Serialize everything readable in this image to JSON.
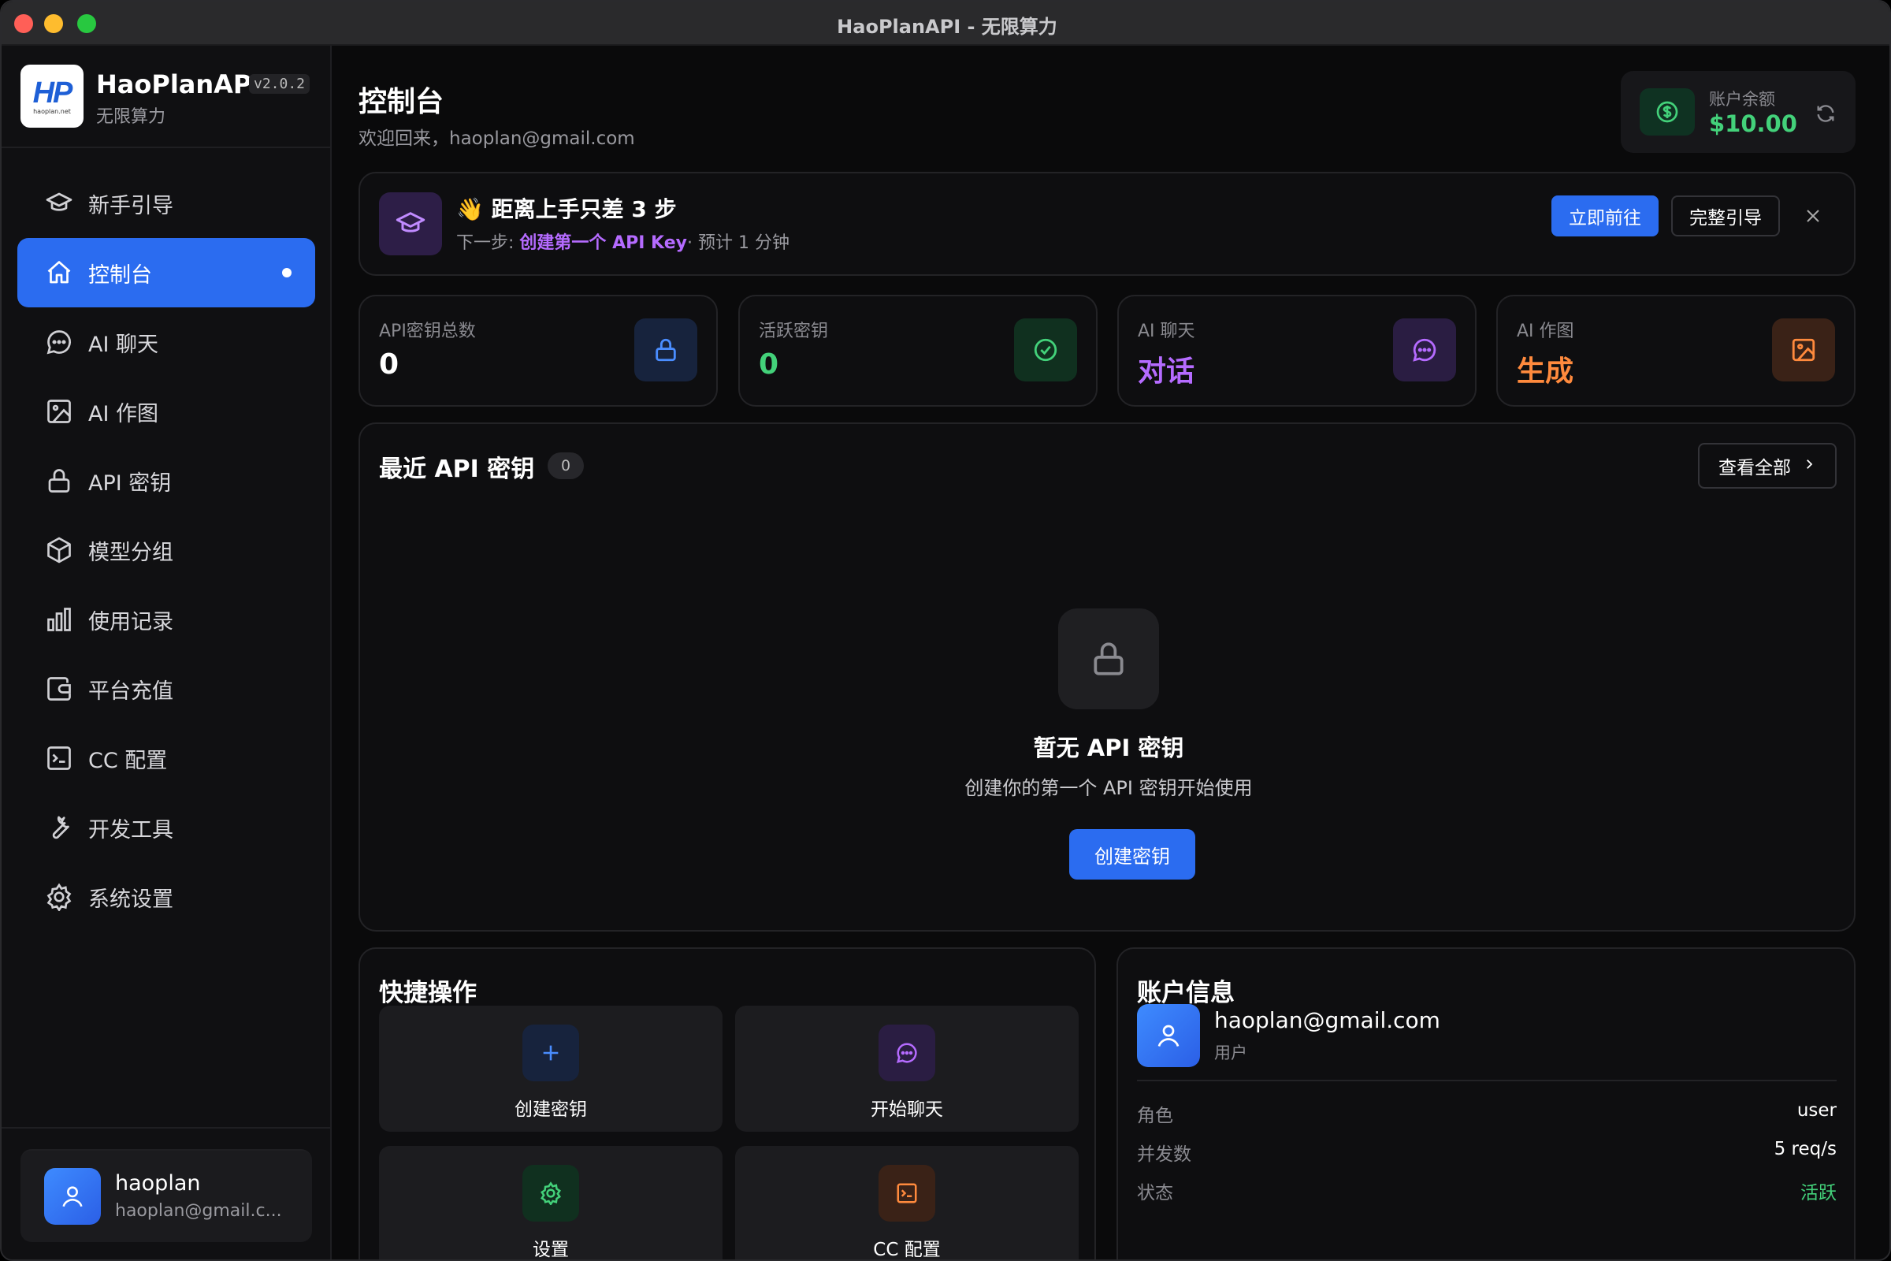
{
  "window": {
    "title": "HaoPlanAPI - 无限算力"
  },
  "brand": {
    "name": "HaoPlanAPI",
    "version": "v2.0.2",
    "subtitle": "无限算力",
    "logo_text": "HP",
    "logo_sub": "haoplan.net"
  },
  "sidebar": {
    "items": [
      {
        "label": "新手引导",
        "icon": "graduation-cap-icon",
        "active": false
      },
      {
        "label": "控制台",
        "icon": "home-icon",
        "active": true
      },
      {
        "label": "AI 聊天",
        "icon": "chat-bubble-icon",
        "active": false
      },
      {
        "label": "AI 作图",
        "icon": "image-icon",
        "active": false
      },
      {
        "label": "API 密钥",
        "icon": "lock-icon",
        "active": false
      },
      {
        "label": "模型分组",
        "icon": "cube-icon",
        "active": false
      },
      {
        "label": "使用记录",
        "icon": "bar-chart-icon",
        "active": false
      },
      {
        "label": "平台充值",
        "icon": "wallet-icon",
        "active": false
      },
      {
        "label": "CC 配置",
        "icon": "terminal-icon",
        "active": false
      },
      {
        "label": "开发工具",
        "icon": "wrench-icon",
        "active": false
      },
      {
        "label": "系统设置",
        "icon": "gear-icon",
        "active": false
      }
    ],
    "user": {
      "name": "haoplan",
      "email": "haoplan@gmail.c..."
    }
  },
  "header": {
    "title": "控制台",
    "welcome": "欢迎回来，haoplan@gmail.com",
    "balance_label": "账户余额",
    "balance_value": "$10.00"
  },
  "onboarding": {
    "title": "👋 距离上手只差 3 步",
    "next_prefix": "下一步: ",
    "next_step": "创建第一个 API Key",
    "estimate": "· 预计 1 分钟",
    "go_label": "立即前往",
    "guide_label": "完整引导"
  },
  "stats": [
    {
      "label": "API密钥总数",
      "value": "0",
      "color": "#ffffff",
      "icon": "lock-icon",
      "icon_bg": "#17233d",
      "icon_color": "#4a8dff"
    },
    {
      "label": "活跃密钥",
      "value": "0",
      "color": "#43d17a",
      "icon": "check-circle-icon",
      "icon_bg": "#10301f",
      "icon_color": "#43d17a"
    },
    {
      "label": "AI 聊天",
      "value": "对话",
      "color": "#b56bff",
      "icon": "chat-bubble-icon",
      "icon_bg": "#2a1d42",
      "icon_color": "#b56bff"
    },
    {
      "label": "AI 作图",
      "value": "生成",
      "color": "#ff8a3d",
      "icon": "image-icon",
      "icon_bg": "#3a2217",
      "icon_color": "#ff8a3d"
    }
  ],
  "recent_keys": {
    "title": "最近 API 密钥",
    "count": "0",
    "view_all": "查看全部",
    "empty_title": "暂无 API 密钥",
    "empty_sub": "创建你的第一个 API 密钥开始使用",
    "create_label": "创建密钥"
  },
  "quick_actions": {
    "title": "快捷操作",
    "items": [
      {
        "label": "创建密钥",
        "icon": "plus-icon"
      },
      {
        "label": "开始聊天",
        "icon": "chat-bubble-icon"
      },
      {
        "label": "设置",
        "icon": "gear-icon"
      },
      {
        "label": "CC 配置",
        "icon": "terminal-icon"
      }
    ]
  },
  "account": {
    "title": "账户信息",
    "email": "haoplan@gmail.com",
    "role_sub": "用户",
    "rows": [
      {
        "key": "角色",
        "value": "user"
      },
      {
        "key": "并发数",
        "value": "5 req/s"
      },
      {
        "key": "状态",
        "value": "活跃"
      }
    ]
  },
  "colors": {
    "accent": "#2b6cf0",
    "success": "#43d17a",
    "purple": "#b56bff",
    "orange": "#ff8a3d"
  }
}
